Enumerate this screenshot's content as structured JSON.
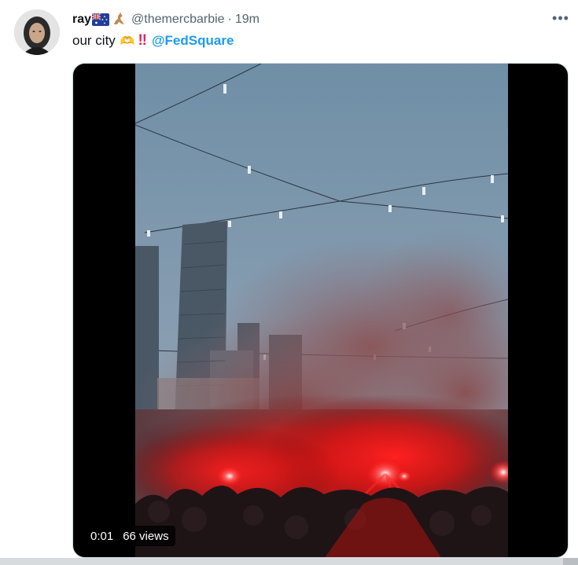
{
  "tweet": {
    "author_name": "ray",
    "handle": "@themercbarbie",
    "separator": "·",
    "time": "19m",
    "more_label": "•••",
    "text": "our city",
    "emoji_hands": "🫶",
    "emoji_bang": "‼",
    "mention": "@FedSquare"
  },
  "video": {
    "timestamp": "0:01",
    "views": "66 views"
  },
  "icons": {
    "flag": "australia-flag-icon",
    "animal": "kangaroo-icon",
    "more": "more-options-icon",
    "hands": "heart-hands-icon",
    "bang": "double-exclamation-icon"
  },
  "colors": {
    "accent": "#1d9bf0",
    "secondary_text": "#536471",
    "flare_red": "#ff1a1a"
  }
}
